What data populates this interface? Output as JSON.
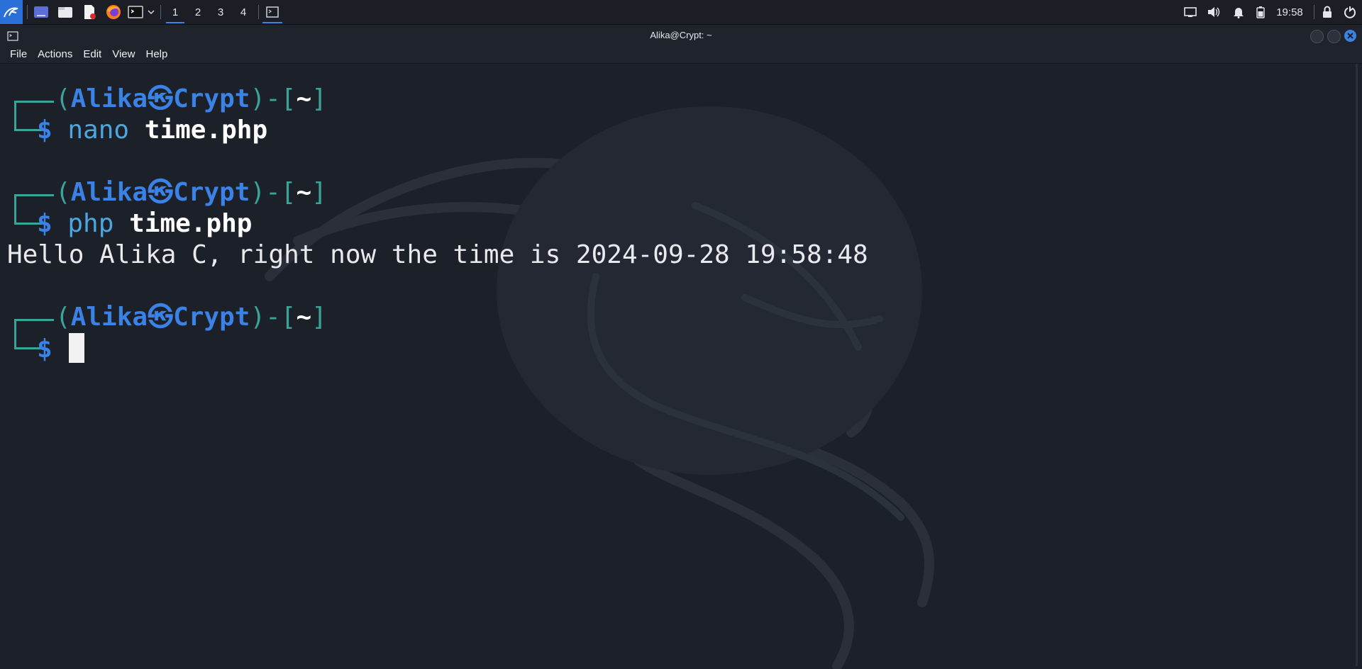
{
  "panel": {
    "workspaces": [
      "1",
      "2",
      "3",
      "4"
    ],
    "active_workspace": "1",
    "clock": "19:58",
    "launchers": [
      "kali-menu-icon",
      "desktop-icon",
      "file-manager-icon",
      "text-editor-icon",
      "firefox-icon",
      "terminal-icon",
      "chevron-down-icon"
    ],
    "tray": [
      "screen-icon",
      "volume-icon",
      "bell-icon",
      "battery-icon",
      "lock-icon",
      "power-icon"
    ]
  },
  "window": {
    "title": "Alika@Crypt: ~",
    "menu": [
      "File",
      "Actions",
      "Edit",
      "View",
      "Help"
    ]
  },
  "terminal": {
    "user": "Alika",
    "host": "Crypt",
    "path": "~",
    "prompt_symbol": "$",
    "skull": "㉿",
    "commands": [
      {
        "cmd": "nano",
        "arg": "time.php"
      },
      {
        "cmd": "php",
        "arg": "time.php"
      }
    ],
    "output": "Hello Alika C, right now the time is 2024-09-28 19:58:48"
  },
  "colors": {
    "accent": "#3b82e6",
    "frame": "#3aa39a",
    "background": "#1c2028"
  }
}
